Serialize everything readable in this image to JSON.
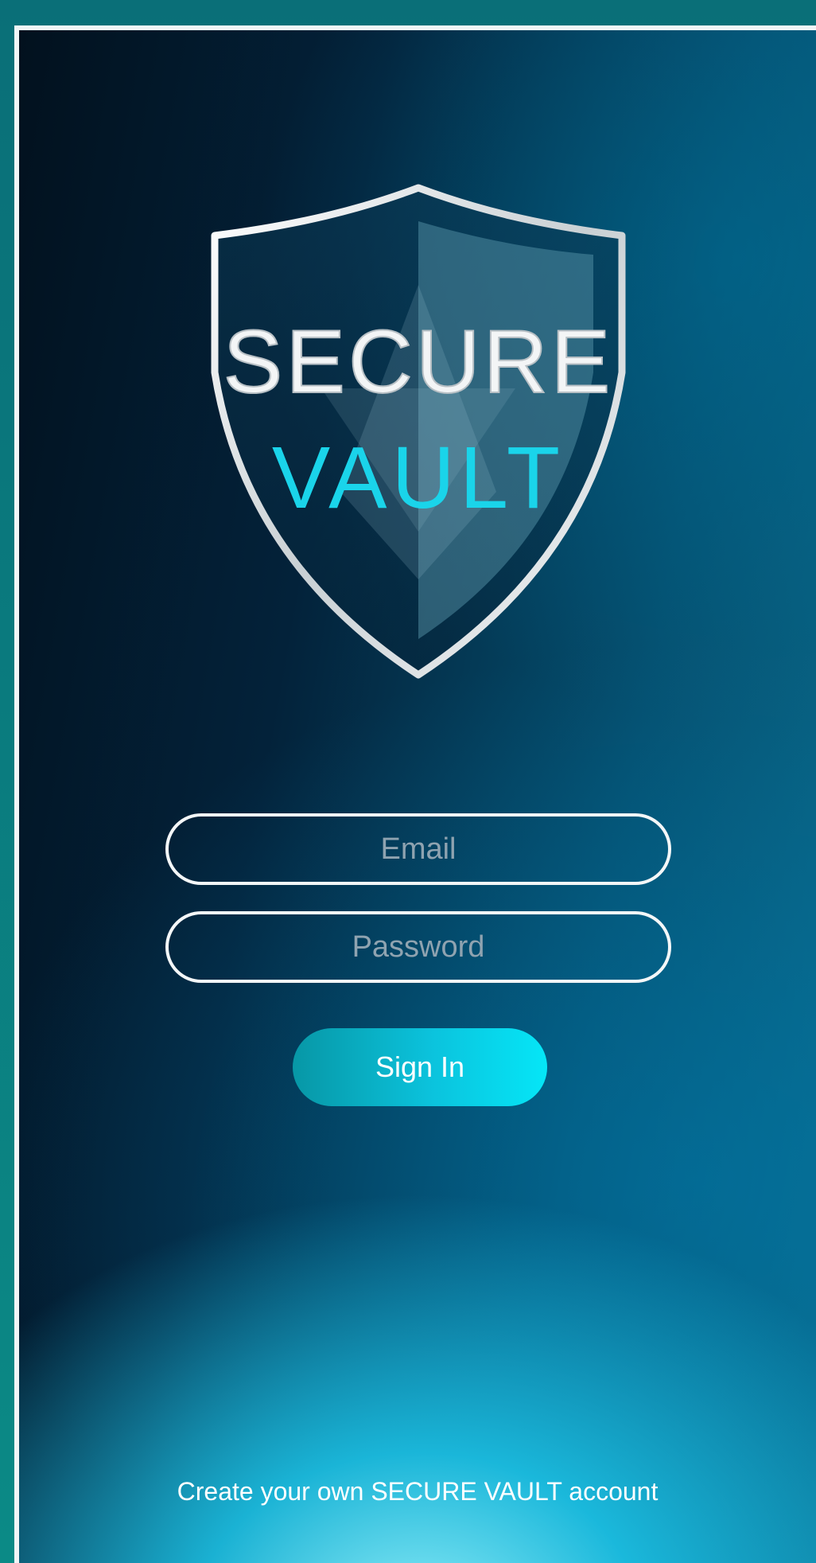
{
  "logo": {
    "line1": "SECURE",
    "line2": "VAULT"
  },
  "form": {
    "email_placeholder": "Email",
    "email_value": "",
    "password_placeholder": "Password",
    "password_value": "",
    "signin_label": "Sign In"
  },
  "footer": {
    "create_account_label": "Create your own SECURE VAULT account"
  },
  "colors": {
    "accent": "#05e6f7",
    "logo_vault_text": "#1ad4ea",
    "frame": "#0b8a86"
  }
}
